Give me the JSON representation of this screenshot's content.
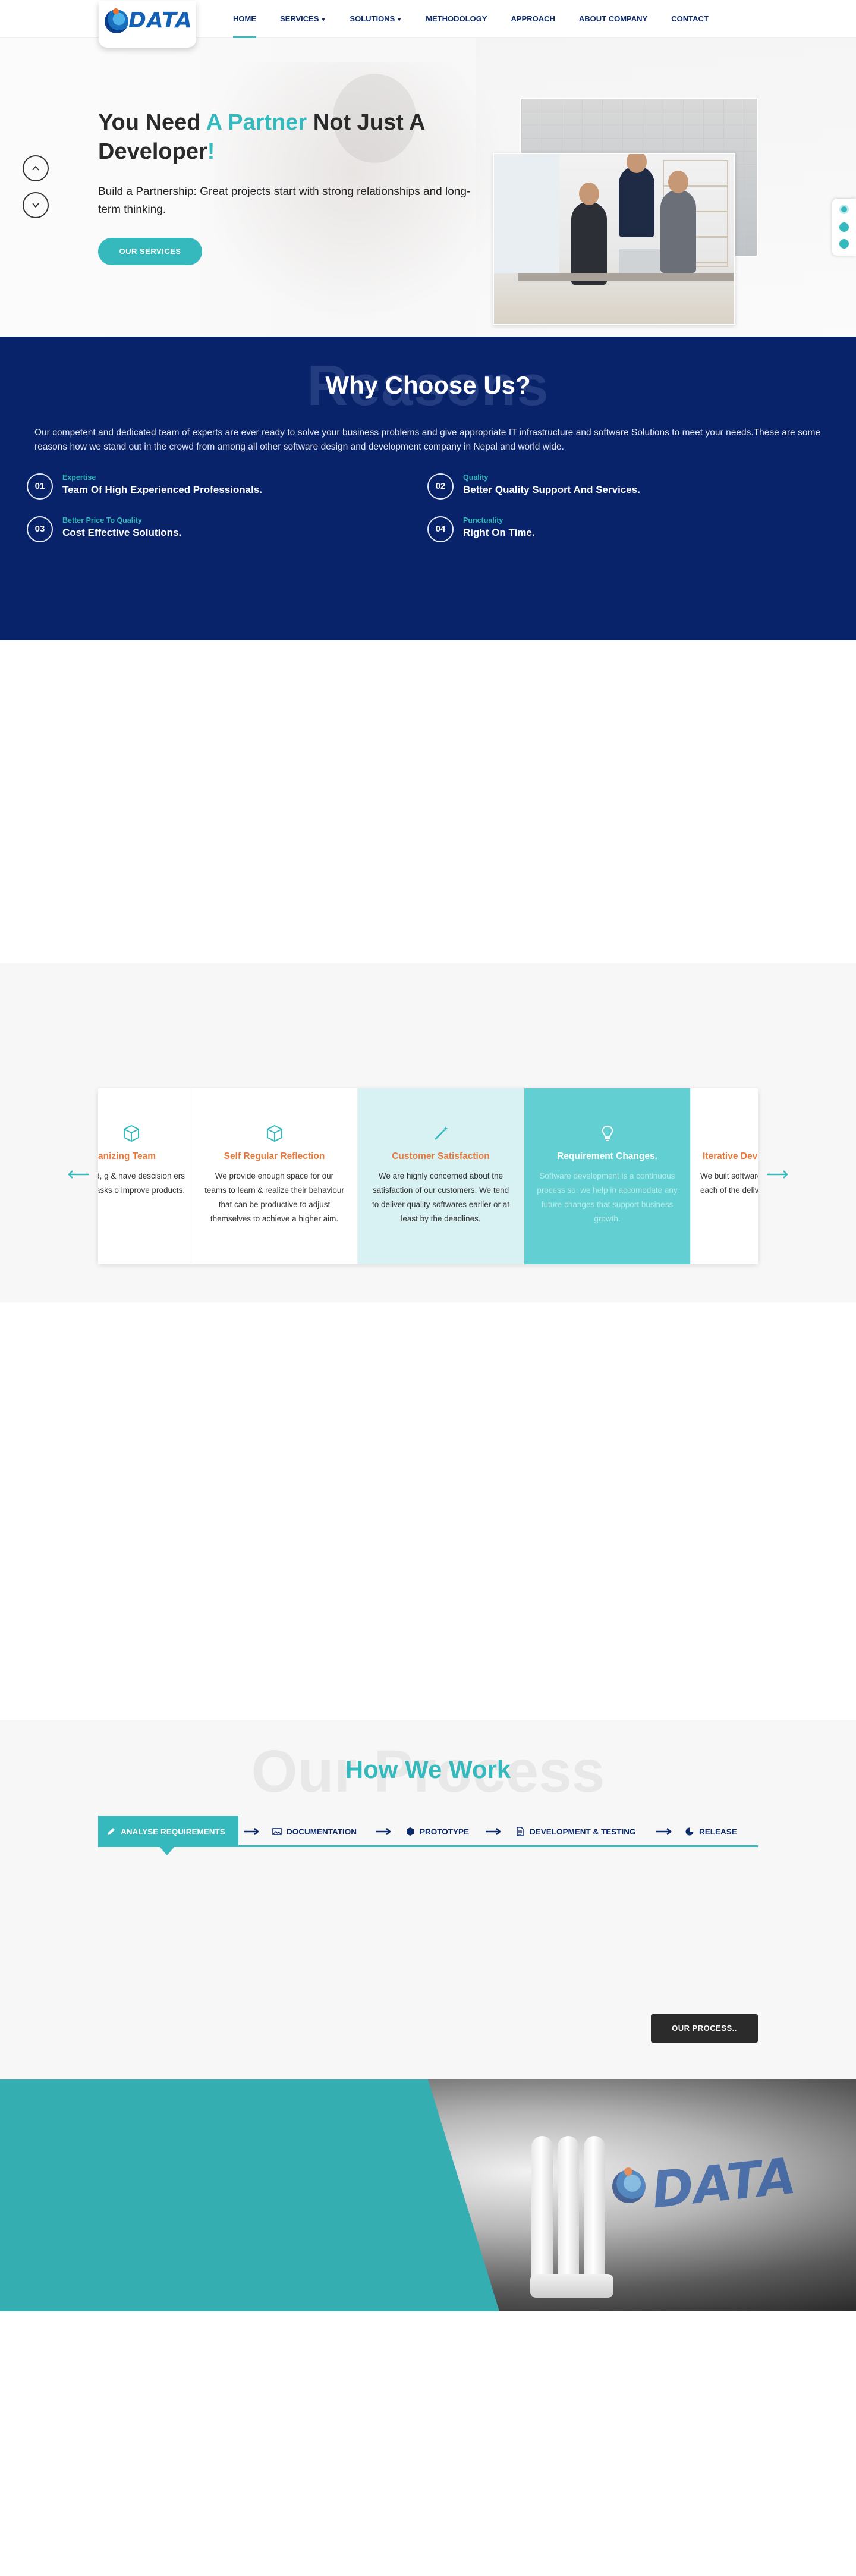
{
  "nav": {
    "logo_text": "DATA",
    "items": [
      {
        "label": "HOME",
        "active": true
      },
      {
        "label": "SERVICES",
        "dropdown": true
      },
      {
        "label": "SOLUTIONS",
        "dropdown": true
      },
      {
        "label": "METHODOLOGY"
      },
      {
        "label": "APPROACH"
      },
      {
        "label": "ABOUT COMPANY"
      },
      {
        "label": "CONTACT"
      }
    ]
  },
  "hero": {
    "title_part1": "You Need ",
    "title_accent": "A Partner",
    "title_part2": " Not Just A Developer",
    "title_end": "!",
    "subtitle": "Build a Partnership: Great projects start with strong relationships and long-term thinking.",
    "cta": "OUR SERVICES"
  },
  "why": {
    "ghost": "Reasons",
    "title": "Why Choose Us?",
    "intro": "Our competent and dedicated team of experts are ever ready to solve your business problems and give appropriate IT infrastructure and software Solutions to meet your needs.These are some reasons how we stand out in the crowd from among all other software design and development company in Nepal and world wide.",
    "reasons": [
      {
        "num": "01",
        "kicker": "Expertise",
        "title": "Team Of High Experienced Professionals."
      },
      {
        "num": "02",
        "kicker": "Quality",
        "title": "Better Quality Support And Services."
      },
      {
        "num": "03",
        "kicker": "Better Price To Quality",
        "title": "Cost Effective Solutions."
      },
      {
        "num": "04",
        "kicker": "Punctuality",
        "title": "Right On Time."
      }
    ]
  },
  "agile": {
    "cards": [
      {
        "title": "anizing Team",
        "desc": "s who are disciplined, g & have descision ers ownership on tasks o improve products."
      },
      {
        "title": "Self Regular Reflection",
        "desc": "We provide enough space for our teams to learn & realize their behaviour that can be productive to adjust themselves to achieve a higher aim."
      },
      {
        "title": "Customer Satisfaction",
        "desc": "We are highly concerned about the satisfaction of our customers. We tend to deliver quality softwares earlier or at least by the deadlines."
      },
      {
        "title": "Requirement Changes.",
        "desc": "Software development is a continuous process so, we help in accomodate any future changes that support business growth."
      },
      {
        "title": "Iterative Dev",
        "desc": "We built software on customer's p each of the deliv ready"
      }
    ]
  },
  "process": {
    "ghost": "Our Process",
    "title": "How We Work",
    "tabs": [
      "ANALYSE REQUIREMENTS",
      "DOCUMENTATION",
      "PROTOTYPE",
      "DEVELOPMENT & TESTING",
      "RELEASE"
    ],
    "button": "OUR PROCESS.."
  },
  "banner": {
    "logo_text": "DATA"
  },
  "colors": {
    "accent": "#35b9bd",
    "navy": "#09236a",
    "orange": "#ea7a3b"
  }
}
